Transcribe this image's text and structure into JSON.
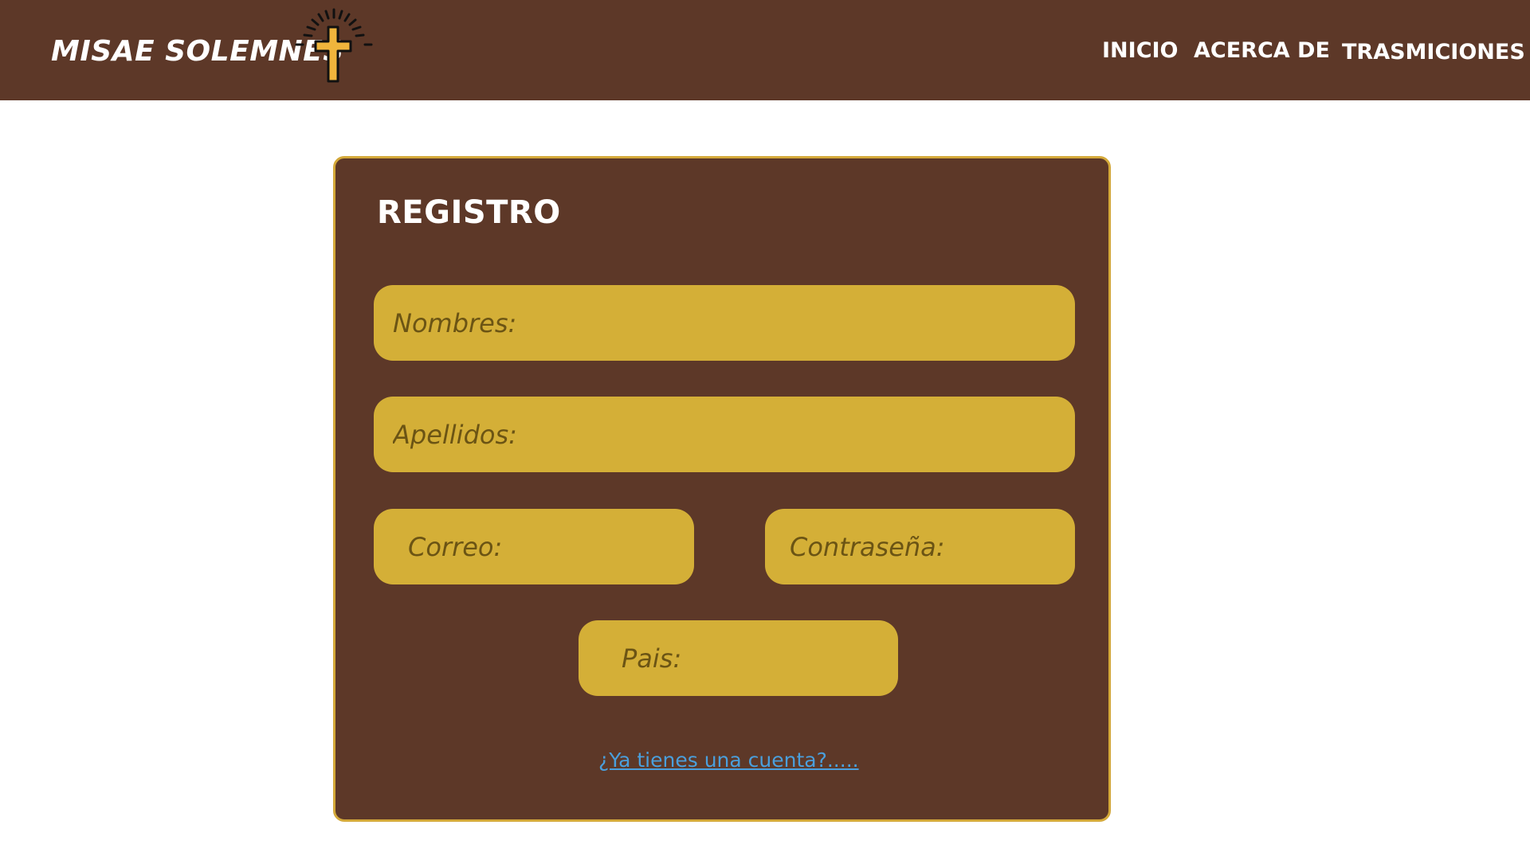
{
  "header": {
    "brand": "MISAE SOLEMNES",
    "logo_icon": "cross-with-rays-icon",
    "nav": [
      {
        "label": "INICIO"
      },
      {
        "label": "ACERCA DE"
      },
      {
        "label": "TRASMICIONES"
      }
    ]
  },
  "form": {
    "title": "REGISTRO",
    "fields": {
      "nombres": {
        "value": "",
        "placeholder": "Nombres:"
      },
      "apellidos": {
        "value": "",
        "placeholder": "Apellidos:"
      },
      "correo": {
        "value": "",
        "placeholder": "Correo:"
      },
      "contrasena": {
        "value": "",
        "placeholder": "Contraseña:"
      },
      "pais": {
        "value": "",
        "placeholder": "Pais:"
      }
    },
    "login_link": "¿Ya tienes una cuenta?....."
  },
  "colors": {
    "header_bg": "#5d3828",
    "card_bg": "#5d3828",
    "card_border": "#d4a93a",
    "field_bg": "#d4af37",
    "link": "#4a9fdc",
    "cross_fill": "#f0b53c"
  }
}
